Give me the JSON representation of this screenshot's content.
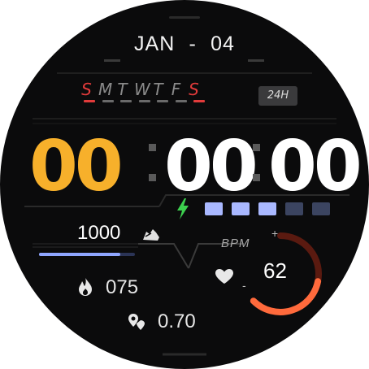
{
  "date": {
    "month": "JAN",
    "separator": "-",
    "day": "04"
  },
  "weekdays": {
    "letters": [
      "S",
      "M",
      "T",
      "W",
      "T",
      "F",
      "S"
    ],
    "colors": [
      "#e23b3b",
      "#8a8a8a",
      "#8a8a8a",
      "#8a8a8a",
      "#8a8a8a",
      "#8a8a8a",
      "#e23b3b"
    ]
  },
  "format_badge": "24H",
  "time": {
    "hours": "00",
    "minutes": "00",
    "seconds": "00",
    "separator": ":"
  },
  "colors": {
    "hours": "#f7b02b",
    "minutes": "#ffffff",
    "accent_blue": "#8fa6ff",
    "battery_full": "#a9b8ff",
    "battery_empty": "#3b4460",
    "charge": "#3ccf4e",
    "ring": "#ff6a3c",
    "ring_track": "#5a1a10"
  },
  "battery": {
    "segments_total": 5,
    "segments_filled": 3,
    "icon": "lightning-bolt-icon"
  },
  "steps": {
    "value": "1000",
    "progress": 0.85,
    "icon": "shoe-icon"
  },
  "calories": {
    "value": "075",
    "icon": "flame-icon"
  },
  "distance": {
    "value": "0.70",
    "icon": "location-pin-icon"
  },
  "heart_rate": {
    "label": "BPM",
    "value": "62",
    "plus": "+",
    "minus": "-",
    "icon": "heart-icon",
    "level": 0.55
  }
}
